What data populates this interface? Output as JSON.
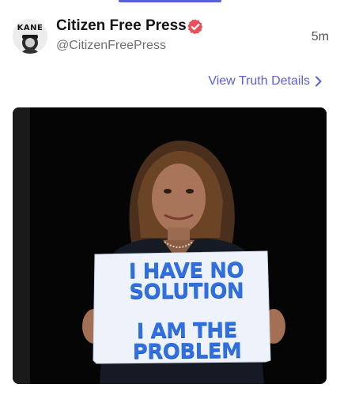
{
  "post": {
    "author": {
      "display_name": "Citizen Free Press",
      "handle": "@CitizenFreePress",
      "avatar_text": "KANE",
      "verified": true
    },
    "timestamp": "5m",
    "details_link_label": "View Truth Details",
    "media": {
      "sign_text_lines": [
        "I HAVE NO",
        "SOLUTION",
        "I AM THE",
        "PROBLEM"
      ]
    }
  },
  "colors": {
    "accent": "#5b5fd6",
    "verified_badge": "#e8505b",
    "sign_text": "#2f6fe0"
  },
  "icons": {
    "verified": "verified-badge-icon",
    "details": "chevron-right-icon"
  }
}
